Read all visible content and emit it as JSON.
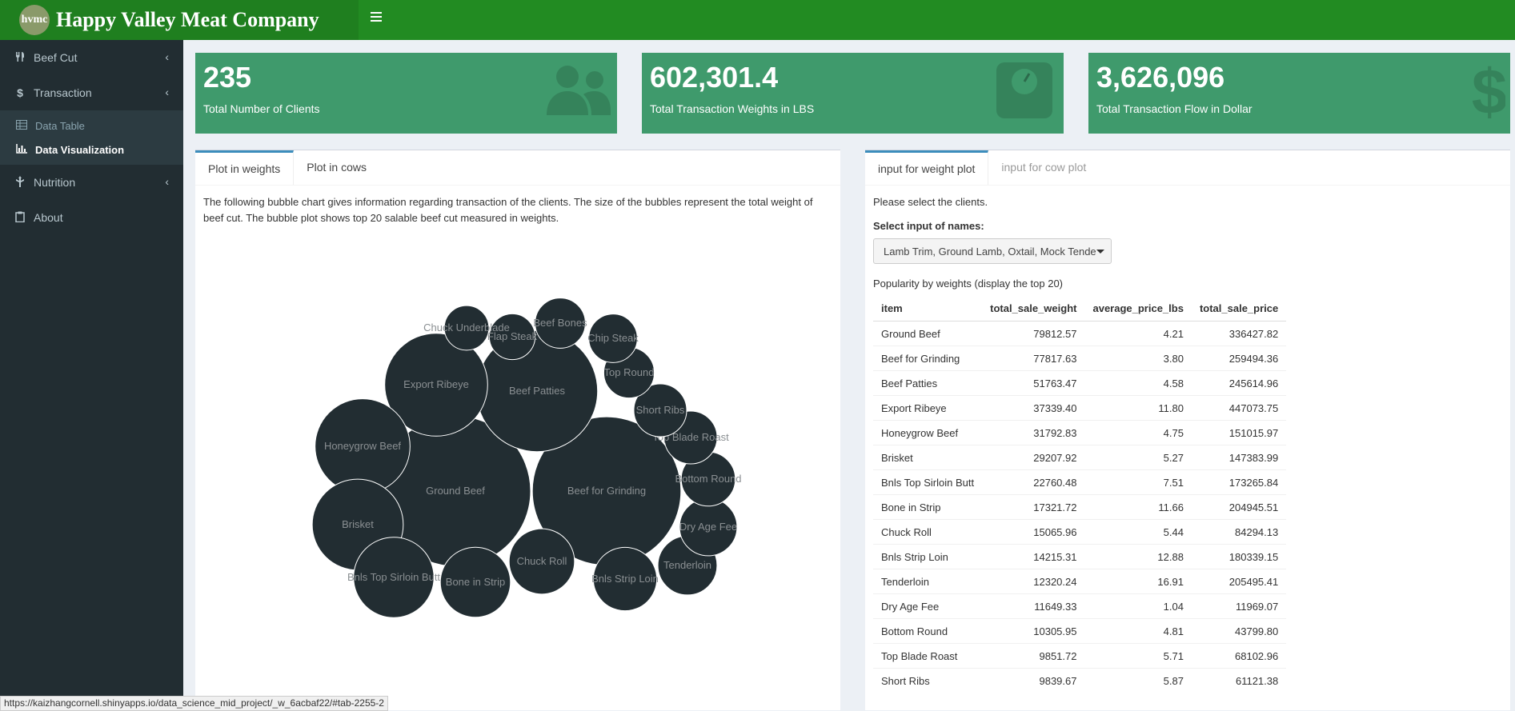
{
  "header": {
    "logo_badge": "hvmc",
    "title": "Happy Valley Meat Company"
  },
  "sidebar": {
    "items": [
      {
        "label": "Beef Cut",
        "icon": "utensils-icon"
      },
      {
        "label": "Transaction",
        "icon": "dollar-icon"
      },
      {
        "label": "Nutrition",
        "icon": "nutrition-icon"
      },
      {
        "label": "About",
        "icon": "clipboard-icon"
      }
    ],
    "submenu": [
      {
        "label": "Data Table",
        "icon": "table-icon"
      },
      {
        "label": "Data Visualization",
        "icon": "bar-chart-icon"
      }
    ]
  },
  "value_boxes": [
    {
      "value": "235",
      "label": "Total Number of Clients",
      "icon": "users-icon"
    },
    {
      "value": "602,301.4",
      "label": "Total Transaction Weights in LBS",
      "icon": "weight-scale-icon"
    },
    {
      "value": "3,626,096",
      "label": "Total Transaction Flow in Dollar",
      "icon": "dollar-icon"
    }
  ],
  "colors": {
    "header": "#228b22",
    "value_box": "#3f9a6c",
    "sidebar": "#222d32",
    "bubble": "#222d32",
    "tab_accent": "#3c8dbc"
  },
  "left_panel": {
    "tabs": [
      "Plot in weights",
      "Plot in cows"
    ],
    "description": "The following bubble chart gives information regarding transaction of the clients. The size of the bubbles represent the total weight of beef cut. The bubble plot shows top 20 salable beef cut measured in weights."
  },
  "chart_data": {
    "type": "bubble",
    "size_metric": "total_sale_weight",
    "bubbles": [
      {
        "label": "Ground Beef",
        "value": 79812.57
      },
      {
        "label": "Beef for Grinding",
        "value": 77817.63
      },
      {
        "label": "Beef Patties",
        "value": 51763.47
      },
      {
        "label": "Export Ribeye",
        "value": 37339.4
      },
      {
        "label": "Honeygrow Beef",
        "value": 31792.83
      },
      {
        "label": "Brisket",
        "value": 29207.92
      },
      {
        "label": "Bnls Top Sirloin Butt",
        "value": 22760.48
      },
      {
        "label": "Bone in Strip",
        "value": 17321.72
      },
      {
        "label": "Chuck Roll",
        "value": 15065.96
      },
      {
        "label": "Bnls Strip Loin",
        "value": 14215.31
      },
      {
        "label": "Tenderloin",
        "value": 12320.24
      },
      {
        "label": "Dry Age Fee",
        "value": 11649.33
      },
      {
        "label": "Bottom Round",
        "value": 10305.95
      },
      {
        "label": "Top Blade Roast",
        "value": 9851.72
      },
      {
        "label": "Short Ribs",
        "value": 9839.67
      },
      {
        "label": "Top Round",
        "value": 9000
      },
      {
        "label": "Chip Steak",
        "value": 8300
      },
      {
        "label": "Beef Bones",
        "value": 8900
      },
      {
        "label": "Flap Steak",
        "value": 7400
      },
      {
        "label": "Chuck Underblade",
        "value": 7000
      }
    ]
  },
  "right_panel": {
    "tabs": [
      "input for weight plot",
      "input for cow plot"
    ],
    "prompt": "Please select the clients.",
    "select_label": "Select input of names:",
    "select_value": "Lamb Trim, Ground Lamb, Oxtail, Mock Tende",
    "table_caption": "Popularity by weights (display the top 20)",
    "table": {
      "columns": [
        "item",
        "total_sale_weight",
        "average_price_lbs",
        "total_sale_price"
      ],
      "rows": [
        [
          "Ground Beef",
          "79812.57",
          "4.21",
          "336427.82"
        ],
        [
          "Beef for Grinding",
          "77817.63",
          "3.80",
          "259494.36"
        ],
        [
          "Beef Patties",
          "51763.47",
          "4.58",
          "245614.96"
        ],
        [
          "Export Ribeye",
          "37339.40",
          "11.80",
          "447073.75"
        ],
        [
          "Honeygrow Beef",
          "31792.83",
          "4.75",
          "151015.97"
        ],
        [
          "Brisket",
          "29207.92",
          "5.27",
          "147383.99"
        ],
        [
          "Bnls Top Sirloin Butt",
          "22760.48",
          "7.51",
          "173265.84"
        ],
        [
          "Bone in Strip",
          "17321.72",
          "11.66",
          "204945.51"
        ],
        [
          "Chuck Roll",
          "15065.96",
          "5.44",
          "84294.13"
        ],
        [
          "Bnls Strip Loin",
          "14215.31",
          "12.88",
          "180339.15"
        ],
        [
          "Tenderloin",
          "12320.24",
          "16.91",
          "205495.41"
        ],
        [
          "Dry Age Fee",
          "11649.33",
          "1.04",
          "11969.07"
        ],
        [
          "Bottom Round",
          "10305.95",
          "4.81",
          "43799.80"
        ],
        [
          "Top Blade Roast",
          "9851.72",
          "5.71",
          "68102.96"
        ],
        [
          "Short Ribs",
          "9839.67",
          "5.87",
          "61121.38"
        ]
      ]
    }
  },
  "status_bar": {
    "url": "https://kaizhangcornell.shinyapps.io/data_science_mid_project/_w_6acbaf22/#tab-2255-2"
  }
}
